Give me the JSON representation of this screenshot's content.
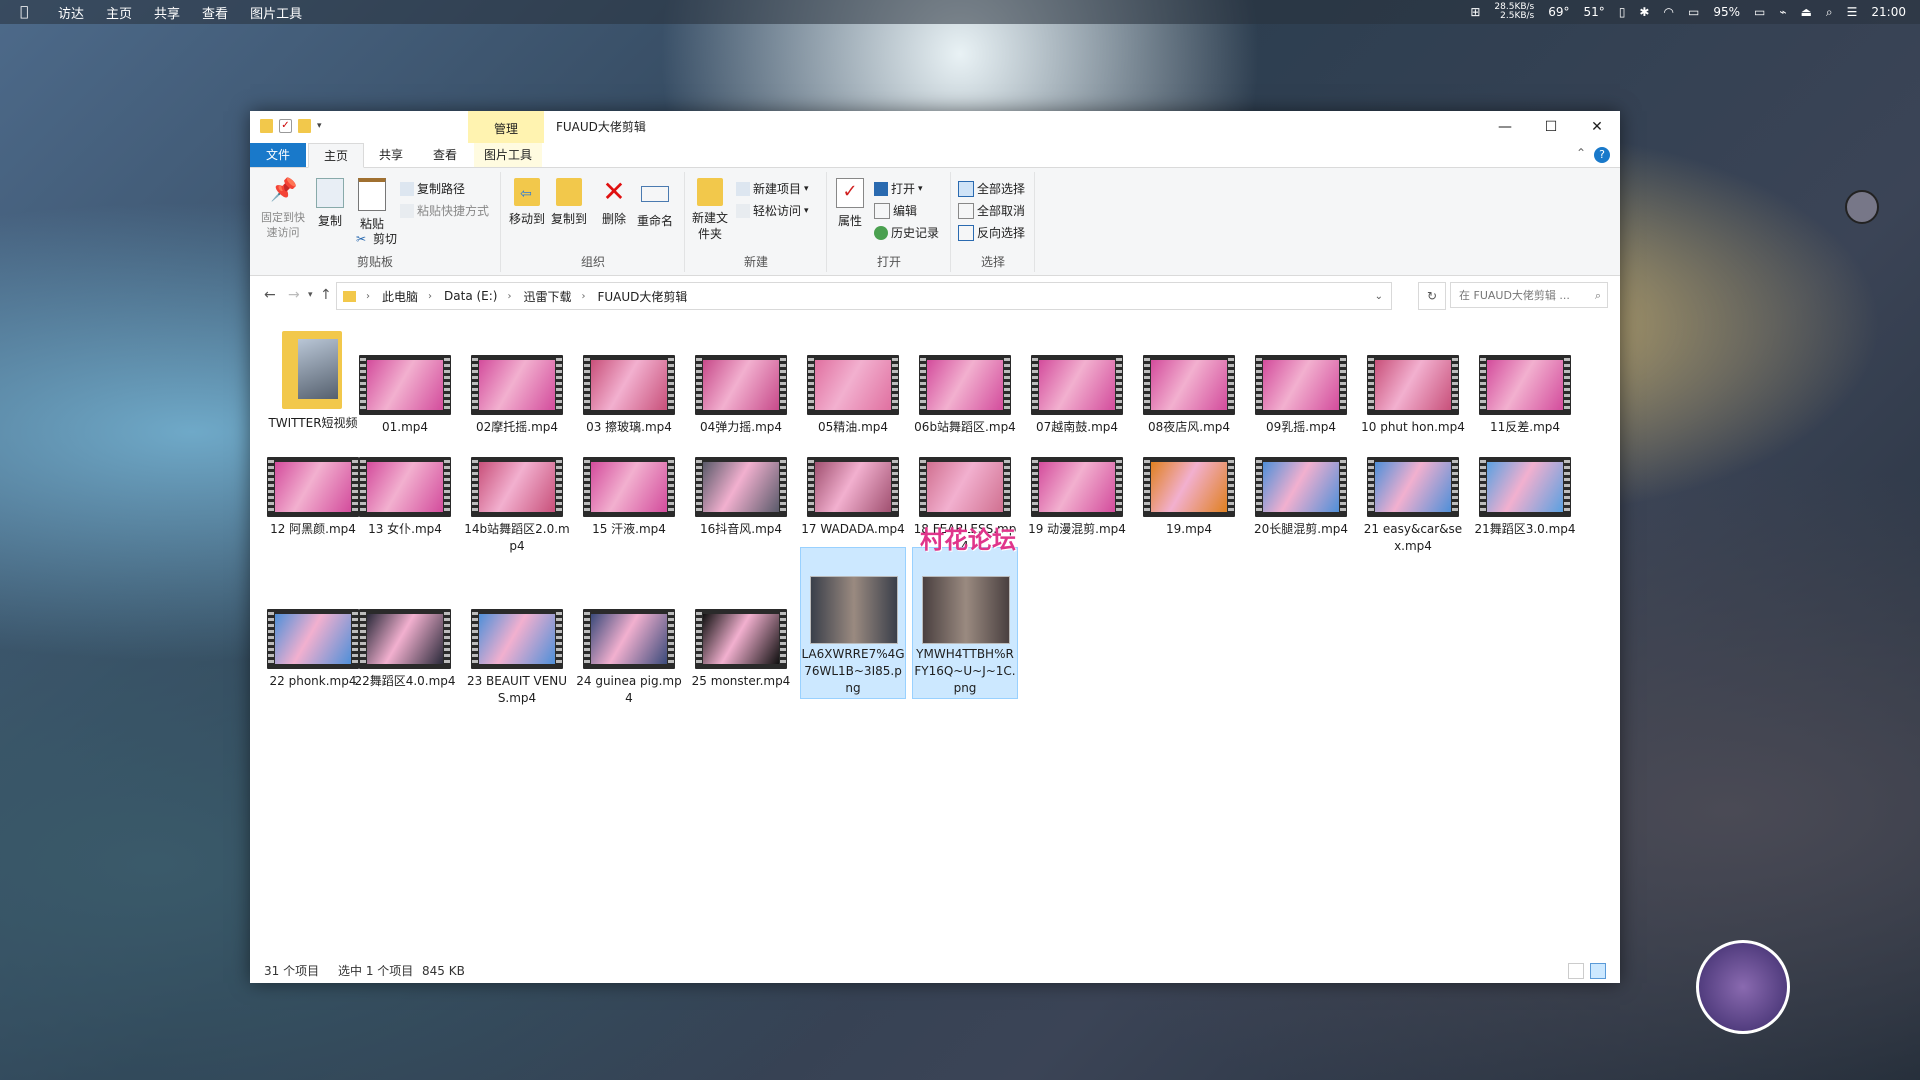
{
  "menubar": {
    "items": [
      "访达",
      "主页",
      "共享",
      "查看",
      "图片工具"
    ],
    "net_up": "28.5KB/s",
    "net_down": "2.5KB/s",
    "temp1": "69°",
    "temp2": "51°",
    "battery": "95%",
    "clock": "21:00"
  },
  "window": {
    "title": "FUAUD大佬剪辑",
    "context_tab": "管理",
    "tabs": [
      "文件",
      "主页",
      "共享",
      "查看",
      "图片工具"
    ],
    "ribbon": {
      "clipboard": {
        "pin": "固定到快速访问",
        "copy": "复制",
        "paste": "粘贴",
        "copy_path": "复制路径",
        "paste_shortcut": "粘贴快捷方式",
        "cut": "剪切",
        "label": "剪贴板"
      },
      "organize": {
        "move_to": "移动到",
        "copy_to": "复制到",
        "delete": "删除",
        "rename": "重命名",
        "label": "组织"
      },
      "new": {
        "new_folder": "新建文件夹",
        "new_item": "新建项目",
        "easy_access": "轻松访问",
        "label": "新建"
      },
      "open": {
        "properties": "属性",
        "open": "打开",
        "edit": "编辑",
        "history": "历史记录",
        "label": "打开"
      },
      "select": {
        "select_all": "全部选择",
        "select_none": "全部取消",
        "invert": "反向选择",
        "label": "选择"
      }
    },
    "address": {
      "crumbs": [
        "此电脑",
        "Data (E:)",
        "迅雷下载",
        "FUAUD大佬剪辑"
      ],
      "search_placeholder": "在 FUAUD大佬剪辑 ..."
    },
    "files": [
      {
        "name": "TWITTER短视频",
        "kind": "folder"
      },
      {
        "name": "01.mp4",
        "kind": "video",
        "tone": "#d34c9c"
      },
      {
        "name": "02摩托摇.mp4",
        "kind": "video",
        "tone": "#d34c9c"
      },
      {
        "name": "03 擦玻璃.mp4",
        "kind": "video",
        "tone": "#c8507a"
      },
      {
        "name": "04弹力摇.mp4",
        "kind": "video",
        "tone": "#c74a8a"
      },
      {
        "name": "05精油.mp4",
        "kind": "video",
        "tone": "#e070a0"
      },
      {
        "name": "06b站舞蹈区.mp4",
        "kind": "video",
        "tone": "#d34c9c"
      },
      {
        "name": "07越南鼓.mp4",
        "kind": "video",
        "tone": "#d34c9c"
      },
      {
        "name": "08夜店风.mp4",
        "kind": "video",
        "tone": "#d34c9c"
      },
      {
        "name": "09乳摇.mp4",
        "kind": "video",
        "tone": "#d34c9c"
      },
      {
        "name": "10 phut hon.mp4",
        "kind": "video",
        "tone": "#c8507a"
      },
      {
        "name": "11反差.mp4",
        "kind": "video",
        "tone": "#d34c9c"
      },
      {
        "name": "12 阿黑颜.mp4",
        "kind": "video",
        "tone": "#d34c9c"
      },
      {
        "name": "13 女仆.mp4",
        "kind": "video",
        "tone": "#d34c9c"
      },
      {
        "name": "14b站舞蹈区2.0.mp4",
        "kind": "video",
        "tone": "#c8507a"
      },
      {
        "name": "15 汗液.mp4",
        "kind": "video",
        "tone": "#d34c9c"
      },
      {
        "name": "16抖音风.mp4",
        "kind": "video",
        "tone": "#5a5a6a"
      },
      {
        "name": "17 WADADA.mp4",
        "kind": "video",
        "tone": "#a05070"
      },
      {
        "name": "18 FEARLESS.mp4",
        "kind": "video",
        "tone": "#d07090"
      },
      {
        "name": "19 动漫混剪.mp4",
        "kind": "video",
        "tone": "#d34c9c"
      },
      {
        "name": "19.mp4",
        "kind": "video",
        "tone": "#e08020"
      },
      {
        "name": "20长腿混剪.mp4",
        "kind": "video",
        "tone": "#4f8fd8"
      },
      {
        "name": "21 easy&car&sex.mp4",
        "kind": "video",
        "tone": "#4f8fd8"
      },
      {
        "name": "21舞蹈区3.0.mp4",
        "kind": "video",
        "tone": "#5aa0e0"
      },
      {
        "name": "22 phonk.mp4",
        "kind": "video",
        "tone": "#4f8fd8"
      },
      {
        "name": "22舞蹈区4.0.mp4",
        "kind": "video",
        "tone": "#2a2a3a"
      },
      {
        "name": "23 BEAUIT VENUS.mp4",
        "kind": "video",
        "tone": "#4f8fd8"
      },
      {
        "name": "24 guinea pig.mp4",
        "kind": "video",
        "tone": "#3a4a7a"
      },
      {
        "name": "25 monster.mp4",
        "kind": "video",
        "tone": "#111111"
      },
      {
        "name": "LA6XWRRE7%4G76WL1B~3I85.png",
        "kind": "png",
        "tone": "#3a3f4a"
      },
      {
        "name": "YMWH4TTBH%RFY16Q~U~J~1C.png",
        "kind": "png",
        "tone": "#4a4040"
      }
    ],
    "status": {
      "count": "31 个项目",
      "selected": "选中 1 个项目",
      "size": "845 KB"
    }
  },
  "watermark": "村花论坛",
  "colors": {
    "accent": "#1979ca",
    "selection": "#cce8ff"
  }
}
